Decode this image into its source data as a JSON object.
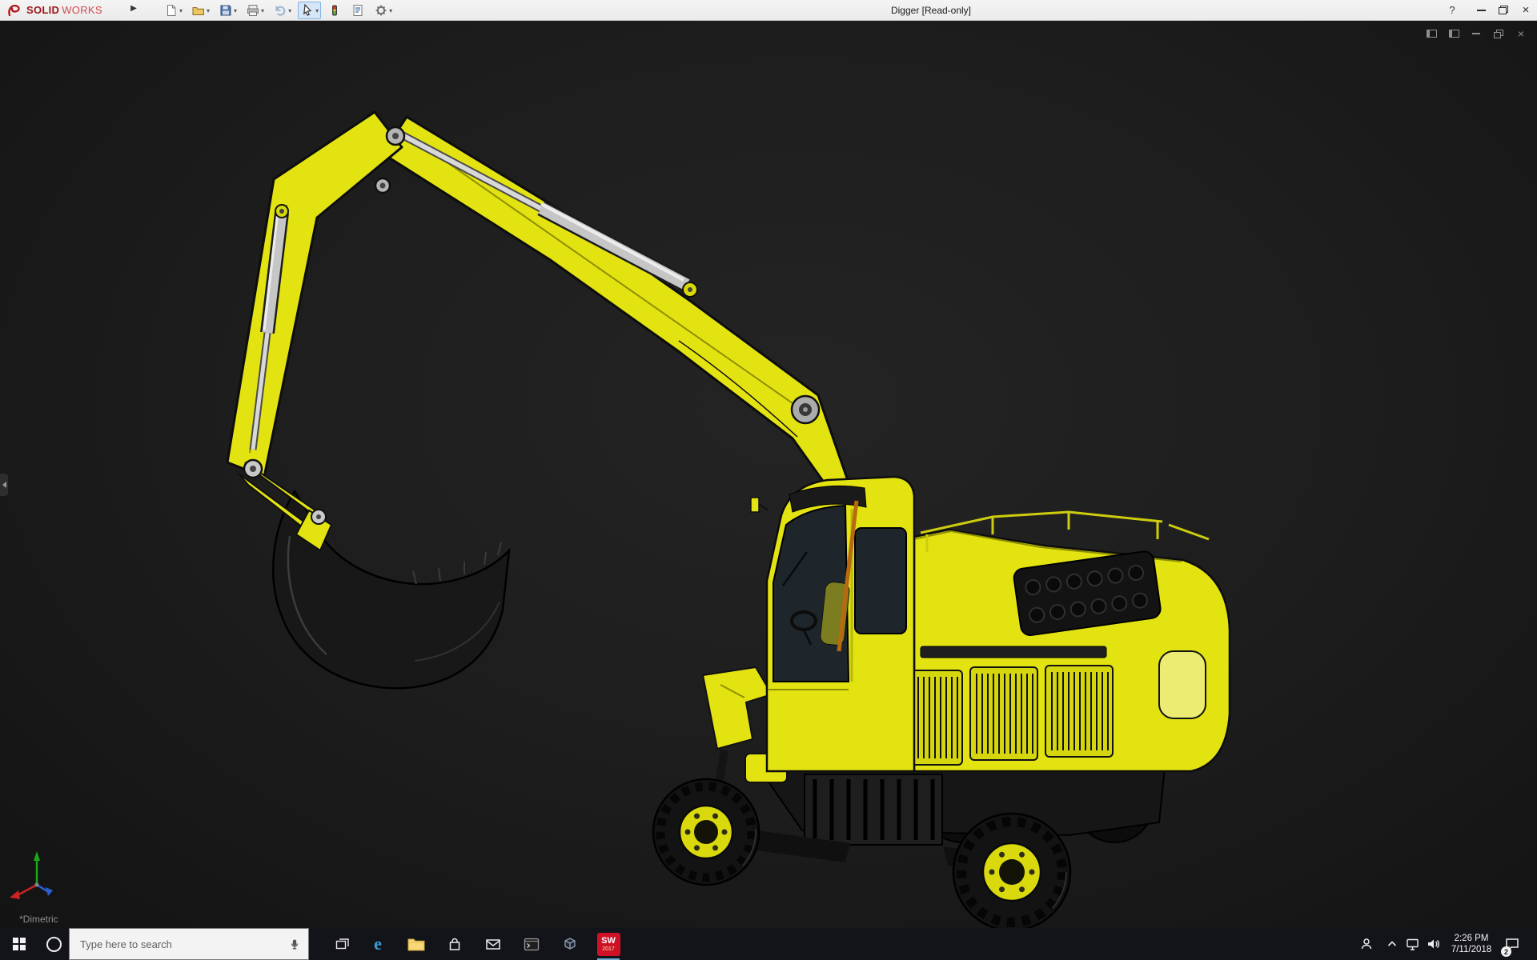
{
  "titlebar": {
    "title": "Digger [Read-only]",
    "brand_bold": "SOLID",
    "brand_light": "WORKS",
    "help_glyph": "?",
    "flyout_glyph": "▶",
    "dropdown_glyph": "▾",
    "close_glyph": "×"
  },
  "toolbar_icons": [
    "new-document",
    "open",
    "save",
    "print",
    "undo",
    "select",
    "rebuild",
    "file-properties",
    "options"
  ],
  "viewport": {
    "orientation_label": "*Dimetric",
    "close_glyph": "×",
    "model_description": "Yellow wheeled excavator (Digger) 3D model shown in dimetric view on dark background"
  },
  "taskbar": {
    "search_placeholder": "Type here to search",
    "time": "2:26 PM",
    "date": "7/11/2018",
    "notification_badge": "2",
    "edge_glyph": "e",
    "solidworks_label": "SW",
    "solidworks_year": "2017",
    "app_icons": [
      "start",
      "cortana",
      "task-view",
      "edge",
      "file-explorer",
      "store",
      "mail",
      "console",
      "cube-app",
      "solidworks-2017",
      "people",
      "hidden-icons-chevron",
      "network",
      "volume",
      "clock",
      "action-center"
    ]
  },
  "colors": {
    "titlebar_bg": "#f0f0f0",
    "viewport_bg": "#1d1d1d",
    "taskbar_bg": "#13131a",
    "brand_red": "#9d1218",
    "model_yellow": "#e3e312",
    "model_yellow_dark": "#b9b906",
    "glass_dark": "#1f262b",
    "strap_orange": "#b86a10"
  }
}
